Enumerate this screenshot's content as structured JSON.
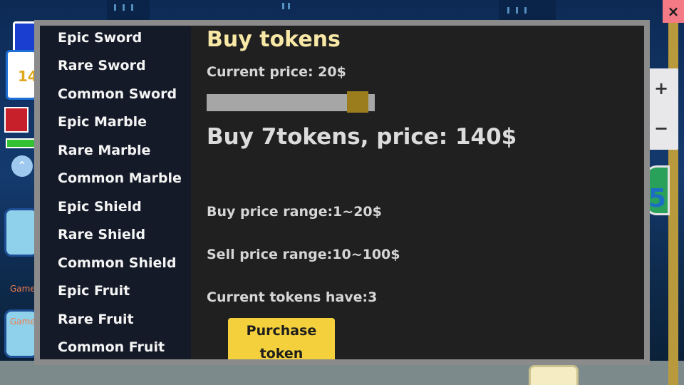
{
  "modal": {
    "sidebar": {
      "items": [
        {
          "label": "Epic Sword"
        },
        {
          "label": "Rare Sword"
        },
        {
          "label": "Common Sword"
        },
        {
          "label": "Epic Marble"
        },
        {
          "label": "Rare Marble"
        },
        {
          "label": "Common Marble"
        },
        {
          "label": "Epic Shield"
        },
        {
          "label": "Rare Shield"
        },
        {
          "label": "Common Shield"
        },
        {
          "label": "Epic Fruit"
        },
        {
          "label": "Rare Fruit"
        },
        {
          "label": "Common Fruit"
        }
      ]
    },
    "title": "Buy tokens",
    "current_price": "Current price: 20$",
    "quantity_slider": {
      "level": 0.9
    },
    "buy_summary": "Buy 7tokens, price: 140$",
    "buy_price_range": "Buy price range:1~20$",
    "sell_price_range": "Sell price range:10~100$",
    "current_tokens": "Current tokens have:3",
    "purchase_button": "Purchase token"
  },
  "close_button": "×",
  "hud": {
    "coin_value": "14",
    "tile_label_1": "Game",
    "tile_label_2": "Game",
    "zoom_in": "+",
    "zoom_out": "−",
    "badge_value": "5"
  },
  "colors": {
    "title": "#f8e8a6",
    "accent_button": "#f3d03c",
    "slider_handle": "#9b7d1e",
    "sidebar_bg": "#151a28",
    "panel_bg": "#202020",
    "frame": "#8b8b8b"
  }
}
